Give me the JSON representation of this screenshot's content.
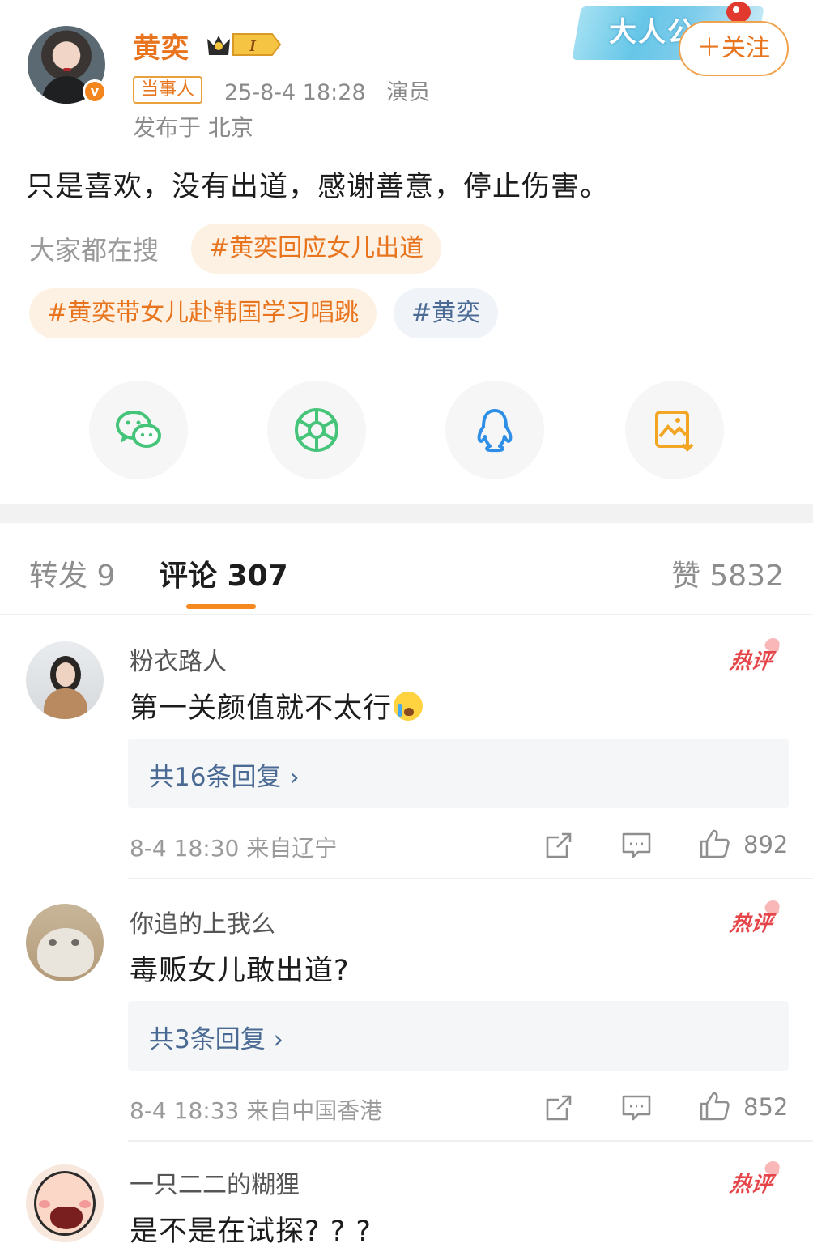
{
  "post": {
    "author_name": "黄奕",
    "vip_label": "I",
    "tag": "当事人",
    "meta": "25-8-4 18:28   演员",
    "location": "发布于 北京",
    "follow_label": "＋关注",
    "banner_text": "大人公",
    "text": "只是喜欢，没有出道，感谢善意，停止伤害。",
    "search_label": "大家都在搜",
    "topics": [
      "#黄奕回应女儿出道",
      "#黄奕带女儿赴韩国学习唱跳",
      "#黄奕"
    ],
    "share_icons": [
      "wechat-icon",
      "moments-icon",
      "qq-icon",
      "save-image-icon"
    ]
  },
  "tabs": {
    "forward": "转发 9",
    "comments": "评论 307",
    "likes": "赞 5832"
  },
  "comments": [
    {
      "name": "粉衣路人",
      "text": "第一关颜值就不太行",
      "hot": "热评",
      "reply_label": "共16条回复 ›",
      "time_location": "8-4 18:30  来自辽宁",
      "likes": "892"
    },
    {
      "name": "你追的上我么",
      "text": "毒贩女儿敢出道?",
      "hot": "热评",
      "reply_label": "共3条回复 ›",
      "time_location": "8-4 18:33  来自中国香港",
      "likes": "852"
    },
    {
      "name": "一只二二的糊狸",
      "text": "是不是在试探? ? ?",
      "hot": "热评"
    }
  ],
  "colors": {
    "accent": "#e8741d",
    "topic_orange_bg": "#fdf1e4",
    "topic_blue": "#4b6b95",
    "hot_red": "#e6464a",
    "reply_blue": "#4a6a93"
  }
}
